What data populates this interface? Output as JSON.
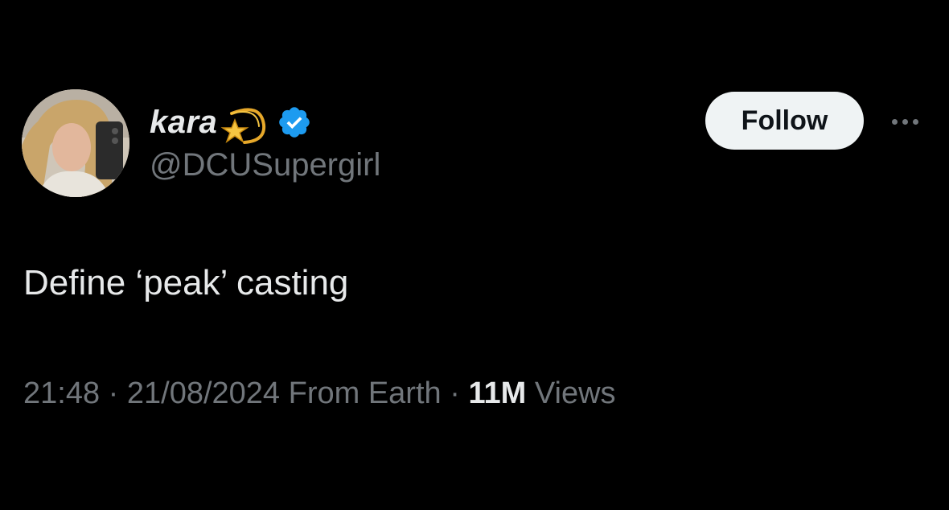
{
  "author": {
    "display_name": "kara",
    "handle": "@DCUSupergirl",
    "emoji_icon": "dizzy-comet-emoji",
    "verified_icon": "verified-badge-icon",
    "verified_color": "#1d9bf0"
  },
  "actions": {
    "follow_label": "Follow",
    "more_icon": "more-options-icon"
  },
  "tweet": {
    "text": "Define ‘peak’ casting"
  },
  "meta": {
    "time": "21:48",
    "separator_1": " · ",
    "date": "21/08/2024",
    "source": " From Earth",
    "separator_2": " · ",
    "views_count": "11M",
    "views_label": " Views"
  },
  "colors": {
    "background": "#000000",
    "primary_text": "#e7e9ea",
    "secondary_text": "#71767b",
    "follow_bg": "#eff3f4",
    "follow_text": "#0f1419"
  }
}
